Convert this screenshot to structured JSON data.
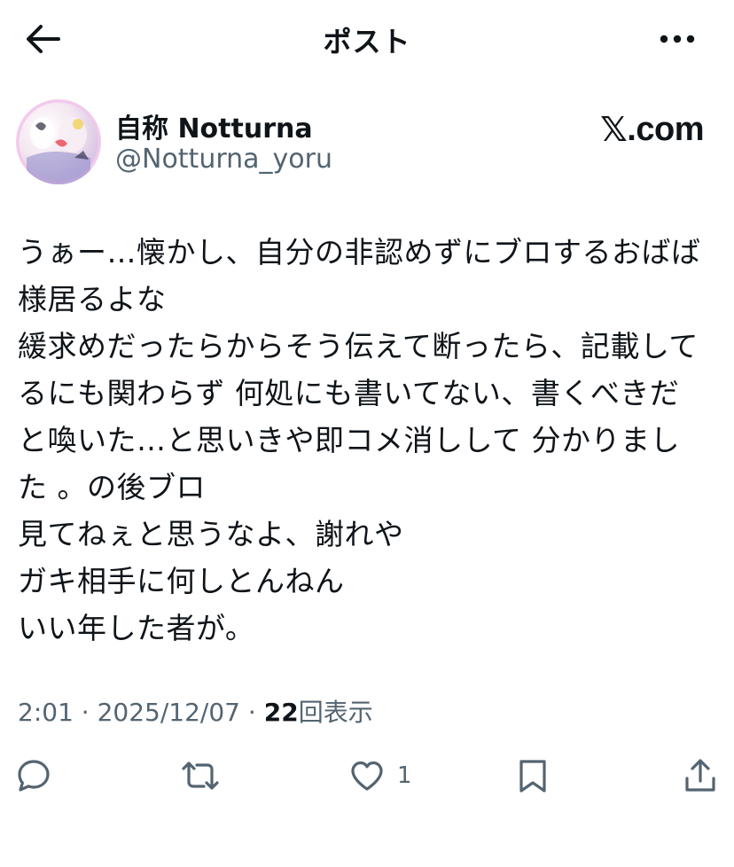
{
  "header": {
    "title": "ポスト"
  },
  "author": {
    "display_name": "自称 Notturna",
    "handle": "@Notturna_yoru"
  },
  "brand": {
    "x_mark": "𝕏",
    "suffix": ".com"
  },
  "post": {
    "lines": [
      "うぁー…懐かし、自分の非認めずにブロするおばば",
      "様居るよな",
      "緩求めだったらからそう伝えて断ったら、記載して",
      "るにも関わらず 何処にも書いてない、書くべきだ",
      "と喚いた…と思いきや即コメ消しして 分かりまし",
      "た 。の後ブロ",
      "見てねぇと思うなよ、謝れや",
      "ガキ相手に何しとんねん",
      "いい年した者が。"
    ]
  },
  "meta": {
    "time": "2:01",
    "separator": "·",
    "date": "2025/12/07",
    "views_count": "22",
    "views_label": "回表示"
  },
  "actions": {
    "like_count": "1"
  },
  "colors": {
    "text": "#0f1419",
    "secondary": "#536471"
  },
  "icons": {
    "back": "back-arrow-icon",
    "more": "more-dots-icon",
    "reply": "reply-bubble-icon",
    "repost": "repost-icon",
    "like": "heart-icon",
    "bookmark": "bookmark-icon",
    "share": "share-icon"
  }
}
